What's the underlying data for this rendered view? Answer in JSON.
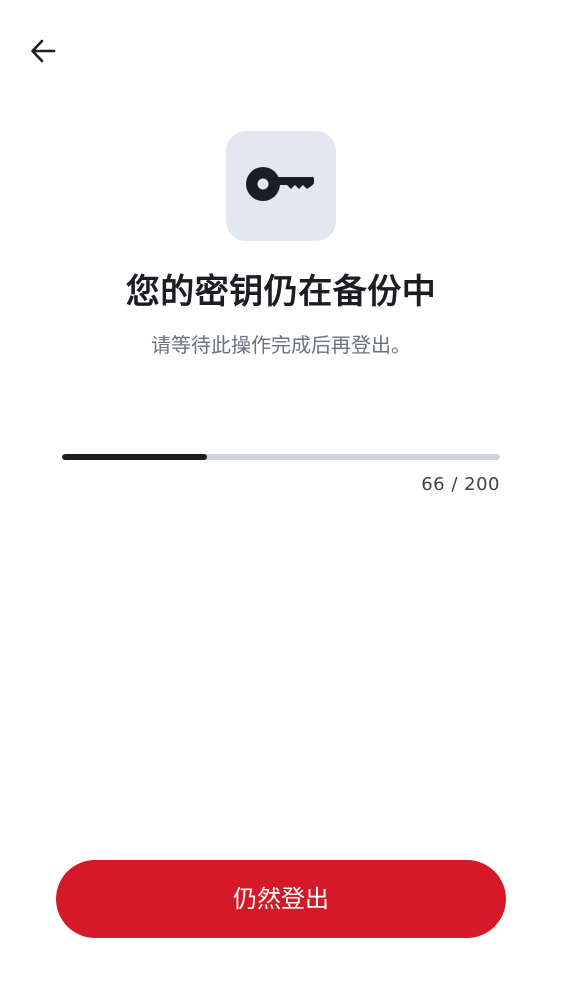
{
  "header": {
    "back_icon": "arrow-left-icon"
  },
  "hero": {
    "icon": "key-icon",
    "title": "您的密钥仍在备份中",
    "subtitle": "请等待此操作完成后再登出。"
  },
  "progress": {
    "current": 66,
    "total": 200,
    "current_text": "66",
    "separator": " / ",
    "total_text": "200"
  },
  "footer": {
    "signout_label": "仍然登出"
  },
  "colors": {
    "accent": "#d51928",
    "tile_bg": "#e3e7ef",
    "progress_fill": "#1b1d22",
    "progress_track": "#cfd5de"
  }
}
